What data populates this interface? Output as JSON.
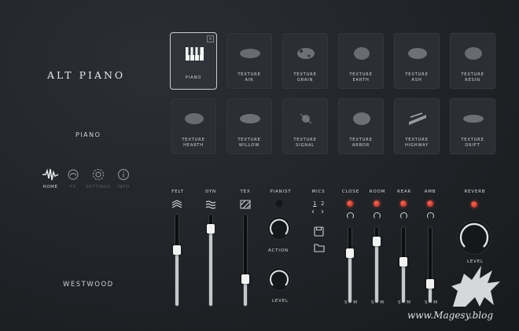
{
  "brand": {
    "title": "ALT PIANO"
  },
  "preset": {
    "name": "PIANO"
  },
  "maker": {
    "name": "WESTWOOD"
  },
  "nav": [
    {
      "label": "HOME",
      "icon": "waveform-icon",
      "active": true
    },
    {
      "label": "FX",
      "icon": "fx-icon",
      "active": false
    },
    {
      "label": "SETTINGS",
      "icon": "gear-icon",
      "active": false
    },
    {
      "label": "INFO",
      "icon": "info-icon",
      "active": false
    }
  ],
  "tiles_row1": [
    {
      "l1": "PIANO",
      "l2": "",
      "selected": true
    },
    {
      "l1": "TEXTURE",
      "l2": "AIR"
    },
    {
      "l1": "TEXTURE",
      "l2": "GRAIN"
    },
    {
      "l1": "TEXTURE",
      "l2": "EARTH"
    },
    {
      "l1": "TEXTURE",
      "l2": "ASH"
    },
    {
      "l1": "TEXTURE",
      "l2": "RESIN"
    }
  ],
  "tiles_row2": [
    {
      "l1": "TEXTURE",
      "l2": "HEARTH"
    },
    {
      "l1": "TEXTURE",
      "l2": "WILLOW"
    },
    {
      "l1": "TEXTURE",
      "l2": "SIGNAL"
    },
    {
      "l1": "TEXTURE",
      "l2": "ARBOR"
    },
    {
      "l1": "TEXTURE",
      "l2": "HIGHWAY"
    },
    {
      "l1": "TEXTURE",
      "l2": "DRIFT"
    }
  ],
  "mixer": {
    "felt": {
      "label": "FELT",
      "level": 0.62
    },
    "dyn": {
      "label": "DYN",
      "level": 0.88
    },
    "tex": {
      "label": "TEX",
      "level": 0.27
    },
    "pianist": {
      "label": "PIANIST",
      "action_label": "ACTION",
      "level_label": "LEVEL"
    },
    "mics": {
      "label": "MICS",
      "pages": [
        "1",
        "2"
      ],
      "save_icon": "save-icon",
      "folder_icon": "folder-icon"
    },
    "channels": [
      {
        "label": "CLOSE",
        "level": 0.68,
        "sm": "S M"
      },
      {
        "label": "ROOM",
        "level": 0.85,
        "sm": "S M"
      },
      {
        "label": "REAR",
        "level": 0.55,
        "sm": "S M"
      },
      {
        "label": "AMB",
        "level": 0.22,
        "sm": "S M"
      }
    ],
    "reverb": {
      "label": "REVERB",
      "level_label": "LEVEL"
    }
  },
  "watermark": {
    "text": "www.Magesy.blog"
  },
  "colors": {
    "accent": "#c6c8ca",
    "led": "#d9483a",
    "background": "#1f2226"
  }
}
